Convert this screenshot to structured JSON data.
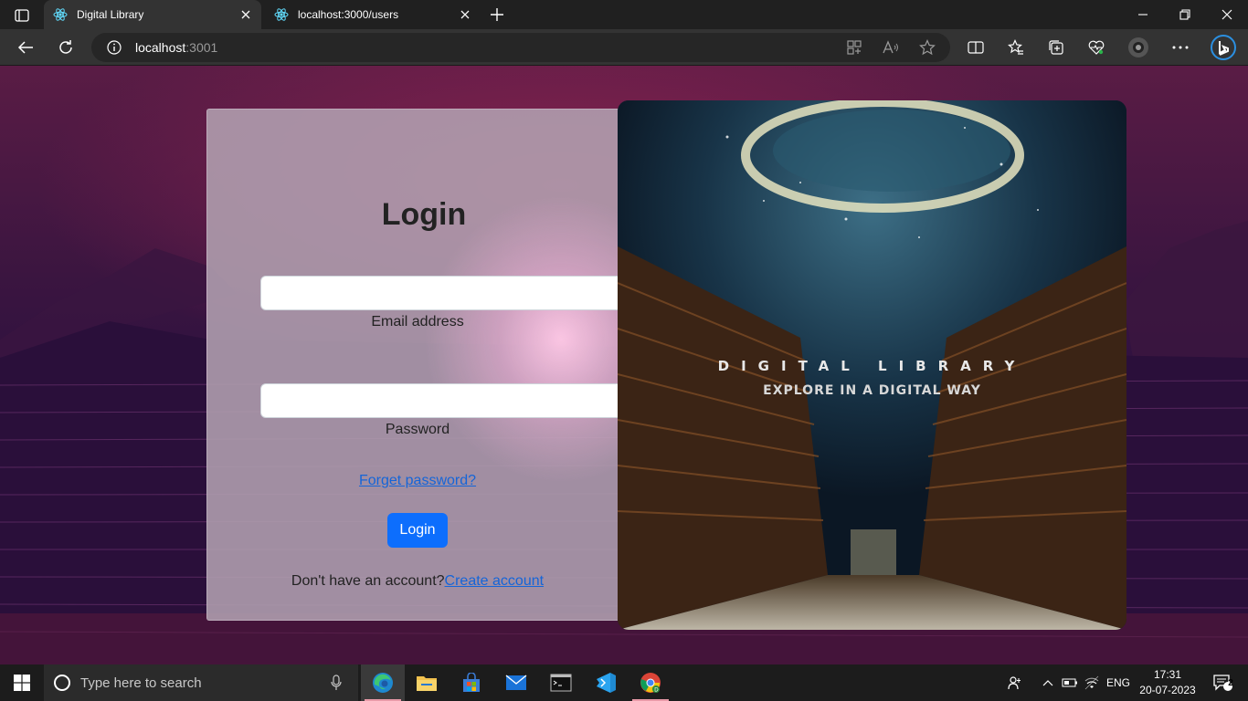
{
  "browser": {
    "tabs": [
      {
        "title": "Digital Library",
        "active": true
      },
      {
        "title": "localhost:3000/users",
        "active": false
      }
    ],
    "address": {
      "host": "localhost",
      "port": ":3001"
    }
  },
  "login": {
    "title": "Login",
    "email_label": "Email address",
    "email_value": "",
    "password_label": "Password",
    "password_value": "",
    "forget_link": "Forget password?",
    "login_button": "Login",
    "signup_prompt": "Don't have an account?",
    "signup_link": "Create account"
  },
  "hero": {
    "title": "DIGITAL LIBRARY",
    "subtitle": "EXPLORE IN A DIGITAL WAY"
  },
  "taskbar": {
    "search_placeholder": "Type here to search",
    "language": "ENG",
    "time": "17:31",
    "date": "20-07-2023",
    "notification_count": "2"
  },
  "colors": {
    "accent": "#0d6efd",
    "link": "#1565d8",
    "browser_bg": "#202020"
  }
}
